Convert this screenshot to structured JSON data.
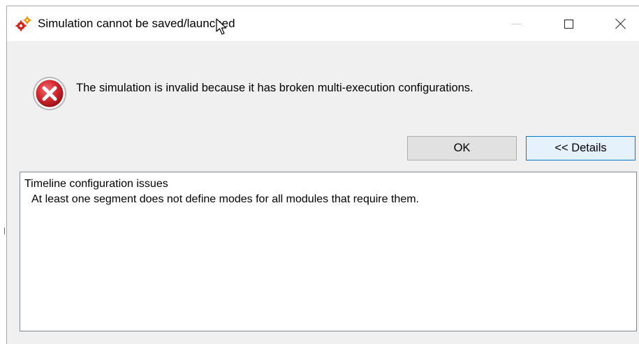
{
  "window": {
    "title": "Simulation cannot be saved/launched",
    "icons": {
      "app": "gear-app-icon",
      "minimize": "minimize-icon",
      "maximize": "maximize-icon",
      "close": "close-icon"
    }
  },
  "dialog": {
    "icon": "error-icon",
    "message": "The simulation is invalid because it has broken multi-execution configurations.",
    "buttons": {
      "ok": "OK",
      "details": "<< Details"
    }
  },
  "details": {
    "lines": [
      "Timeline configuration issues",
      "At least one segment does not define modes for all modules that require them."
    ]
  },
  "colors": {
    "dialog_bg": "#f0f0f0",
    "accent_border": "#0078d7",
    "error_red": "#c0202a",
    "app_icon_red": "#d9261c",
    "app_icon_orange": "#f29100"
  }
}
